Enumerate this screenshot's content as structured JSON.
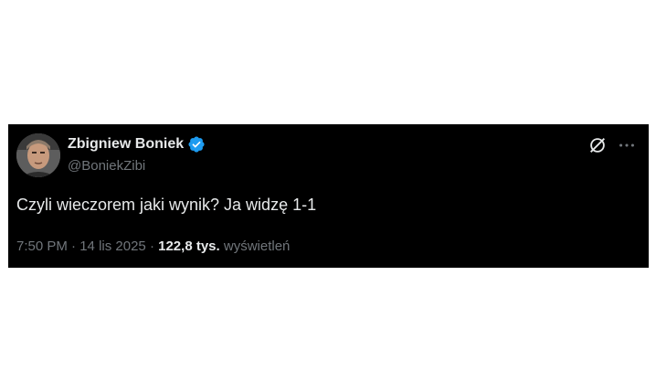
{
  "tweet": {
    "author": {
      "display_name": "Zbigniew Boniek",
      "handle": "@BoniekZibi",
      "verified": true,
      "avatar_icon": "profile-photo"
    },
    "text": "Czyli wieczorem jaki wynik? Ja widzę 1-1",
    "time": "7:50 PM",
    "separator": "·",
    "date": "14 lis 2025",
    "views_count": "122,8 tys.",
    "views_label": "wyświetleń"
  },
  "icons": {
    "verified": "verified-badge-icon",
    "grok": "grok-icon",
    "more": "more-options-icon"
  },
  "colors": {
    "background": "#000000",
    "primary_text": "#e7e9ea",
    "secondary_text": "#71767b",
    "verified_blue": "#1d9bf0"
  }
}
